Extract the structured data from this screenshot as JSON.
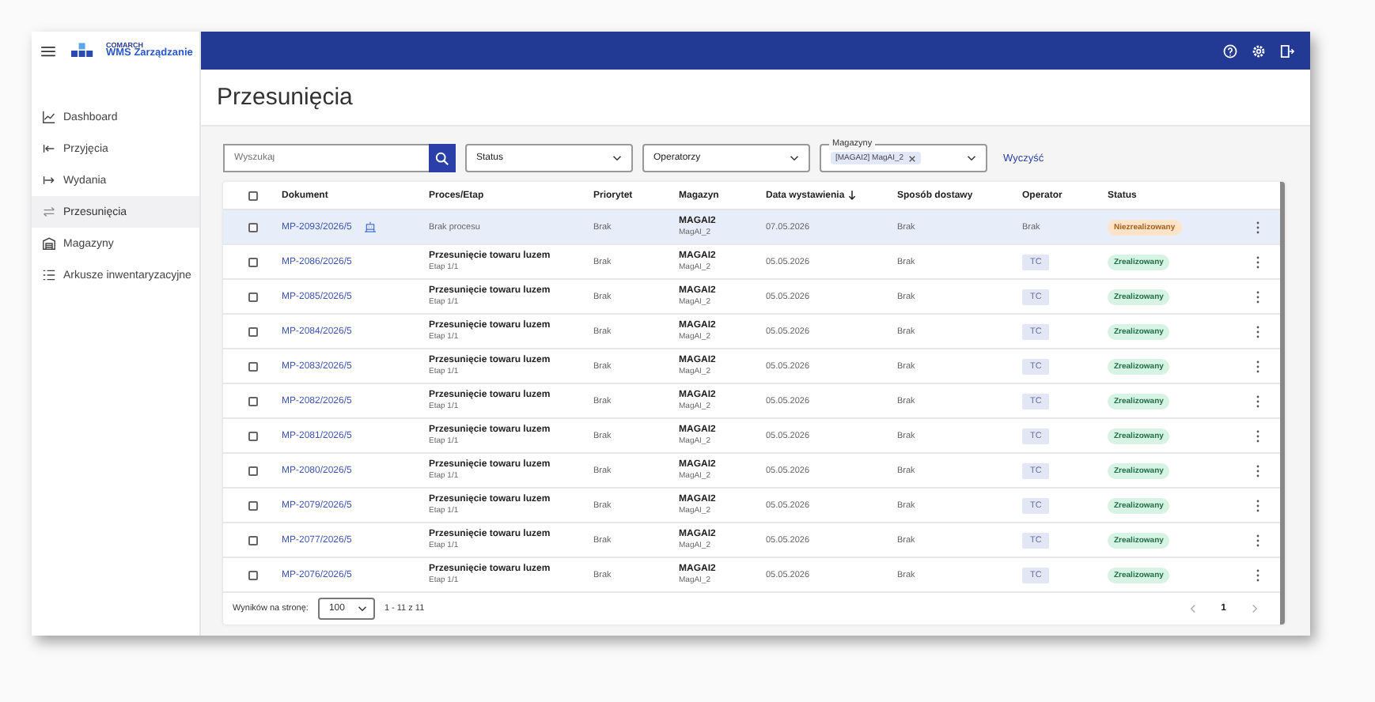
{
  "logo": {
    "brand": "COMARCH",
    "product": "WMS Zarządzanie"
  },
  "sidebar": {
    "items": [
      {
        "label": "Dashboard",
        "selected": false
      },
      {
        "label": "Przyjęcia",
        "selected": false
      },
      {
        "label": "Wydania",
        "selected": false
      },
      {
        "label": "Przesunięcia",
        "selected": true
      },
      {
        "label": "Magazyny",
        "selected": false
      },
      {
        "label": "Arkusze inwentaryzacyjne",
        "selected": false
      }
    ]
  },
  "page_title": "Przesunięcia",
  "filters": {
    "search": {
      "placeholder": "Wyszukaj"
    },
    "status": {
      "placeholder": "Status"
    },
    "operators": {
      "placeholder": "Operatorzy"
    },
    "warehouses": {
      "label": "Magazyny",
      "chip": "[MAGAI2] MagAI_2"
    },
    "clear_button": "Wyczyść"
  },
  "table": {
    "header_checked": false,
    "columns": [
      {
        "label": "Dokument",
        "sorted": false
      },
      {
        "label": "Proces/Etap",
        "sorted": false
      },
      {
        "label": "Priorytet",
        "sorted": false
      },
      {
        "label": "Magazyn",
        "sorted": false
      },
      {
        "label": "Data wystawienia",
        "sorted": true
      },
      {
        "label": "Sposób dostawy",
        "sorted": false
      },
      {
        "label": "Operator",
        "sorted": false
      },
      {
        "label": "Status",
        "sorted": false
      }
    ],
    "rows": [
      {
        "checked": false,
        "hovered": true,
        "document": "MP-2093/2026/5",
        "has_icon": true,
        "process": {
          "title": "Brak procesu"
        },
        "priority": "Brak",
        "warehouse": {
          "code": "MAGAI2",
          "name": "MagAI_2"
        },
        "date": "07.05.2026",
        "delivery": "Brak",
        "operator": {
          "kind": "plain",
          "text": "Brak"
        },
        "status": {
          "kind": "pending",
          "label": "Niezrealizowany"
        }
      },
      {
        "checked": false,
        "hovered": false,
        "document": "MP-2086/2026/5",
        "has_icon": false,
        "process": {
          "title": "Przesunięcie towaru luzem",
          "step": "Etap 1/1"
        },
        "priority": "Brak",
        "warehouse": {
          "code": "MAGAI2",
          "name": "MagAI_2"
        },
        "date": "05.05.2026",
        "delivery": "Brak",
        "operator": {
          "kind": "chip",
          "text": "TC"
        },
        "status": {
          "kind": "done",
          "label": "Zrealizowany"
        }
      },
      {
        "checked": false,
        "hovered": false,
        "document": "MP-2085/2026/5",
        "has_icon": false,
        "process": {
          "title": "Przesunięcie towaru luzem",
          "step": "Etap 1/1"
        },
        "priority": "Brak",
        "warehouse": {
          "code": "MAGAI2",
          "name": "MagAI_2"
        },
        "date": "05.05.2026",
        "delivery": "Brak",
        "operator": {
          "kind": "chip",
          "text": "TC"
        },
        "status": {
          "kind": "done",
          "label": "Zrealizowany"
        }
      },
      {
        "checked": false,
        "hovered": false,
        "document": "MP-2084/2026/5",
        "has_icon": false,
        "process": {
          "title": "Przesunięcie towaru luzem",
          "step": "Etap 1/1"
        },
        "priority": "Brak",
        "warehouse": {
          "code": "MAGAI2",
          "name": "MagAI_2"
        },
        "date": "05.05.2026",
        "delivery": "Brak",
        "operator": {
          "kind": "chip",
          "text": "TC"
        },
        "status": {
          "kind": "done",
          "label": "Zrealizowany"
        }
      },
      {
        "checked": false,
        "hovered": false,
        "document": "MP-2083/2026/5",
        "has_icon": false,
        "process": {
          "title": "Przesunięcie towaru luzem",
          "step": "Etap 1/1"
        },
        "priority": "Brak",
        "warehouse": {
          "code": "MAGAI2",
          "name": "MagAI_2"
        },
        "date": "05.05.2026",
        "delivery": "Brak",
        "operator": {
          "kind": "chip",
          "text": "TC"
        },
        "status": {
          "kind": "done",
          "label": "Zrealizowany"
        }
      },
      {
        "checked": false,
        "hovered": false,
        "document": "MP-2082/2026/5",
        "has_icon": false,
        "process": {
          "title": "Przesunięcie towaru luzem",
          "step": "Etap 1/1"
        },
        "priority": "Brak",
        "warehouse": {
          "code": "MAGAI2",
          "name": "MagAI_2"
        },
        "date": "05.05.2026",
        "delivery": "Brak",
        "operator": {
          "kind": "chip",
          "text": "TC"
        },
        "status": {
          "kind": "done",
          "label": "Zrealizowany"
        }
      },
      {
        "checked": false,
        "hovered": false,
        "document": "MP-2081/2026/5",
        "has_icon": false,
        "process": {
          "title": "Przesunięcie towaru luzem",
          "step": "Etap 1/1"
        },
        "priority": "Brak",
        "warehouse": {
          "code": "MAGAI2",
          "name": "MagAI_2"
        },
        "date": "05.05.2026",
        "delivery": "Brak",
        "operator": {
          "kind": "chip",
          "text": "TC"
        },
        "status": {
          "kind": "done",
          "label": "Zrealizowany"
        }
      },
      {
        "checked": false,
        "hovered": false,
        "document": "MP-2080/2026/5",
        "has_icon": false,
        "process": {
          "title": "Przesunięcie towaru luzem",
          "step": "Etap 1/1"
        },
        "priority": "Brak",
        "warehouse": {
          "code": "MAGAI2",
          "name": "MagAI_2"
        },
        "date": "05.05.2026",
        "delivery": "Brak",
        "operator": {
          "kind": "chip",
          "text": "TC"
        },
        "status": {
          "kind": "done",
          "label": "Zrealizowany"
        }
      },
      {
        "checked": false,
        "hovered": false,
        "document": "MP-2079/2026/5",
        "has_icon": false,
        "process": {
          "title": "Przesunięcie towaru luzem",
          "step": "Etap 1/1"
        },
        "priority": "Brak",
        "warehouse": {
          "code": "MAGAI2",
          "name": "MagAI_2"
        },
        "date": "05.05.2026",
        "delivery": "Brak",
        "operator": {
          "kind": "chip",
          "text": "TC"
        },
        "status": {
          "kind": "done",
          "label": "Zrealizowany"
        }
      },
      {
        "checked": false,
        "hovered": false,
        "document": "MP-2077/2026/5",
        "has_icon": false,
        "process": {
          "title": "Przesunięcie towaru luzem",
          "step": "Etap 1/1"
        },
        "priority": "Brak",
        "warehouse": {
          "code": "MAGAI2",
          "name": "MagAI_2"
        },
        "date": "05.05.2026",
        "delivery": "Brak",
        "operator": {
          "kind": "chip",
          "text": "TC"
        },
        "status": {
          "kind": "done",
          "label": "Zrealizowany"
        }
      },
      {
        "checked": false,
        "hovered": false,
        "document": "MP-2076/2026/5",
        "has_icon": false,
        "process": {
          "title": "Przesunięcie towaru luzem",
          "step": "Etap 1/1"
        },
        "priority": "Brak",
        "warehouse": {
          "code": "MAGAI2",
          "name": "MagAI_2"
        },
        "date": "05.05.2026",
        "delivery": "Brak",
        "operator": {
          "kind": "chip",
          "text": "TC"
        },
        "status": {
          "kind": "done",
          "label": "Zrealizowany"
        }
      }
    ]
  },
  "pager": {
    "label": "Wyników na stronę:",
    "page_size": "100",
    "range": "1 - 11 z 11",
    "pages": [
      {
        "label": "1",
        "selected": true
      }
    ]
  }
}
